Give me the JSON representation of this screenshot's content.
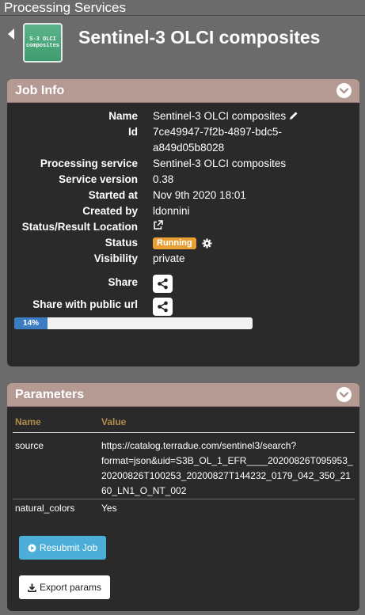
{
  "app": {
    "title": "Processing Services"
  },
  "header": {
    "thumbnail_line1": "S-3 OLCI",
    "thumbnail_line2": "composites",
    "title": "Sentinel-3 OLCI composites"
  },
  "job_info": {
    "title": "Job Info",
    "rows": [
      {
        "label": "Name",
        "value": "Sentinel-3 OLCI composites"
      },
      {
        "label": "Id",
        "value": "7ce49947-7f2b-4897-bdc5-",
        "value2": "a849d05b8028"
      },
      {
        "label": "Processing service",
        "value": "Sentinel-3 OLCI composites"
      },
      {
        "label": "Service version",
        "value": "0.38"
      },
      {
        "label": "Started at",
        "value": "Nov 9th 2020 18:01"
      },
      {
        "label": "Created by",
        "value": "ldonnini"
      },
      {
        "label": "Status/Result Location",
        "value": ""
      },
      {
        "label": "Status",
        "value": "Running"
      },
      {
        "label": "Visibility",
        "value": "private"
      }
    ],
    "share_label": "Share",
    "share_public_label": "Share with public url",
    "progress_percent": 14,
    "progress_text": "14%",
    "status_color": "#e8a035"
  },
  "parameters": {
    "title": "Parameters",
    "headers": [
      "Name",
      "Value"
    ],
    "rows": [
      {
        "name": "source",
        "value_lines": [
          "https://catalog.terradue.com/sentinel3/search?",
          "format=json&uid=S3B_OL_1_EFR____20200826T095953_",
          "20200826T100253_20200827T144232_0179_042_350_21",
          "60_LN1_O_NT_002"
        ]
      },
      {
        "name": "natural_colors",
        "value_lines": [
          "Yes"
        ]
      }
    ],
    "resubmit_label": "Resubmit Job",
    "export_label": "Export params"
  }
}
